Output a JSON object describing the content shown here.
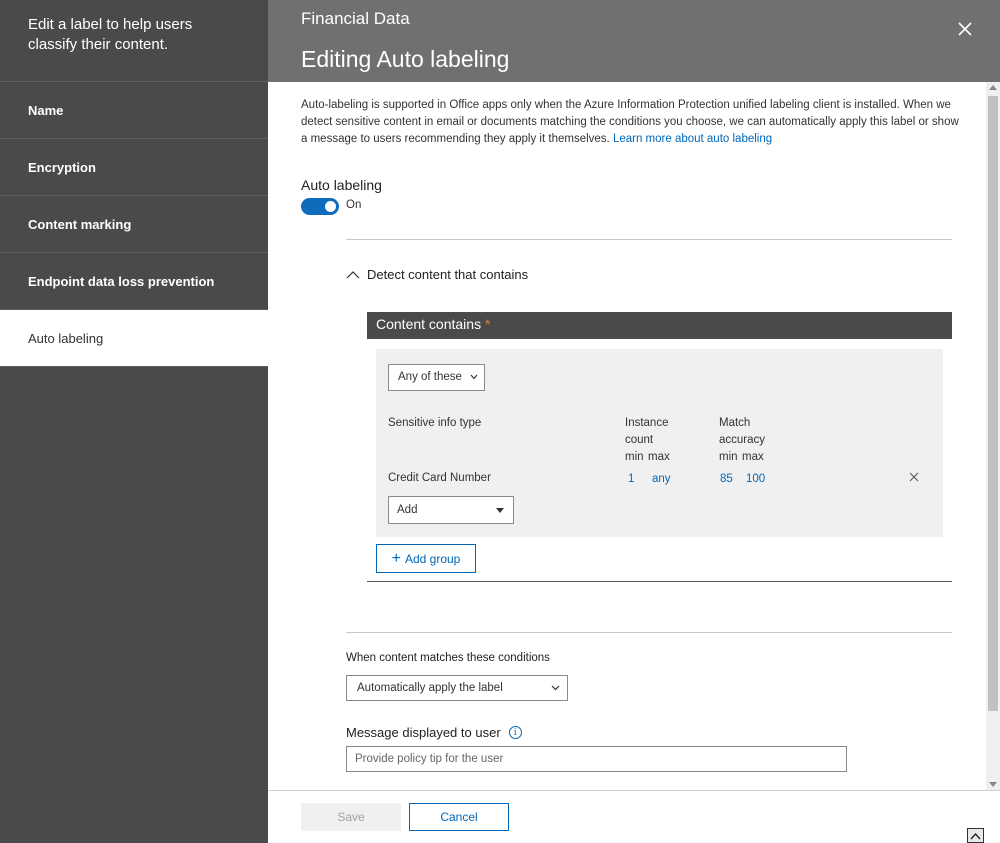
{
  "sidebar": {
    "description": "Edit a label to help users classify their content.",
    "items": [
      {
        "label": "Name"
      },
      {
        "label": "Encryption"
      },
      {
        "label": "Content marking"
      },
      {
        "label": "Endpoint data loss prevention"
      },
      {
        "label": "Auto labeling"
      }
    ]
  },
  "header": {
    "subtitle": "Financial Data",
    "title": "Editing Auto labeling"
  },
  "intro": {
    "text": "Auto-labeling is supported in Office apps only when the Azure Information Protection unified labeling client is installed. When we detect sensitive content in email or documents matching the conditions you choose, we can automatically apply this label or show a message to users recommending they apply it themselves.",
    "link": "Learn more about auto labeling"
  },
  "auto_labeling": {
    "label": "Auto labeling",
    "state": "On"
  },
  "detect": {
    "label": "Detect content that contains"
  },
  "content_contains": {
    "title": "Content contains",
    "required_mark": "*",
    "match_select": "Any of these",
    "columns": {
      "type": "Sensitive info type",
      "instance": "Instance",
      "count": "count",
      "match": "Match",
      "accuracy": "accuracy",
      "min": "min",
      "max": "max"
    },
    "rows": [
      {
        "type": "Credit Card Number",
        "instance_min": "1",
        "instance_max": "any",
        "accuracy_min": "85",
        "accuracy_max": "100"
      }
    ],
    "add_label": "Add",
    "add_group_label": "Add group"
  },
  "conditions": {
    "label": "When content matches these conditions",
    "selected": "Automatically apply the label"
  },
  "message": {
    "label": "Message displayed to user",
    "info": "i",
    "placeholder": "Provide policy tip for the user"
  },
  "footer": {
    "save": "Save",
    "cancel": "Cancel"
  },
  "colors": {
    "accent": "#0067b8",
    "sidebar_bg": "#4a4a4a",
    "header_bg": "#707070",
    "required": "#e0843a"
  }
}
